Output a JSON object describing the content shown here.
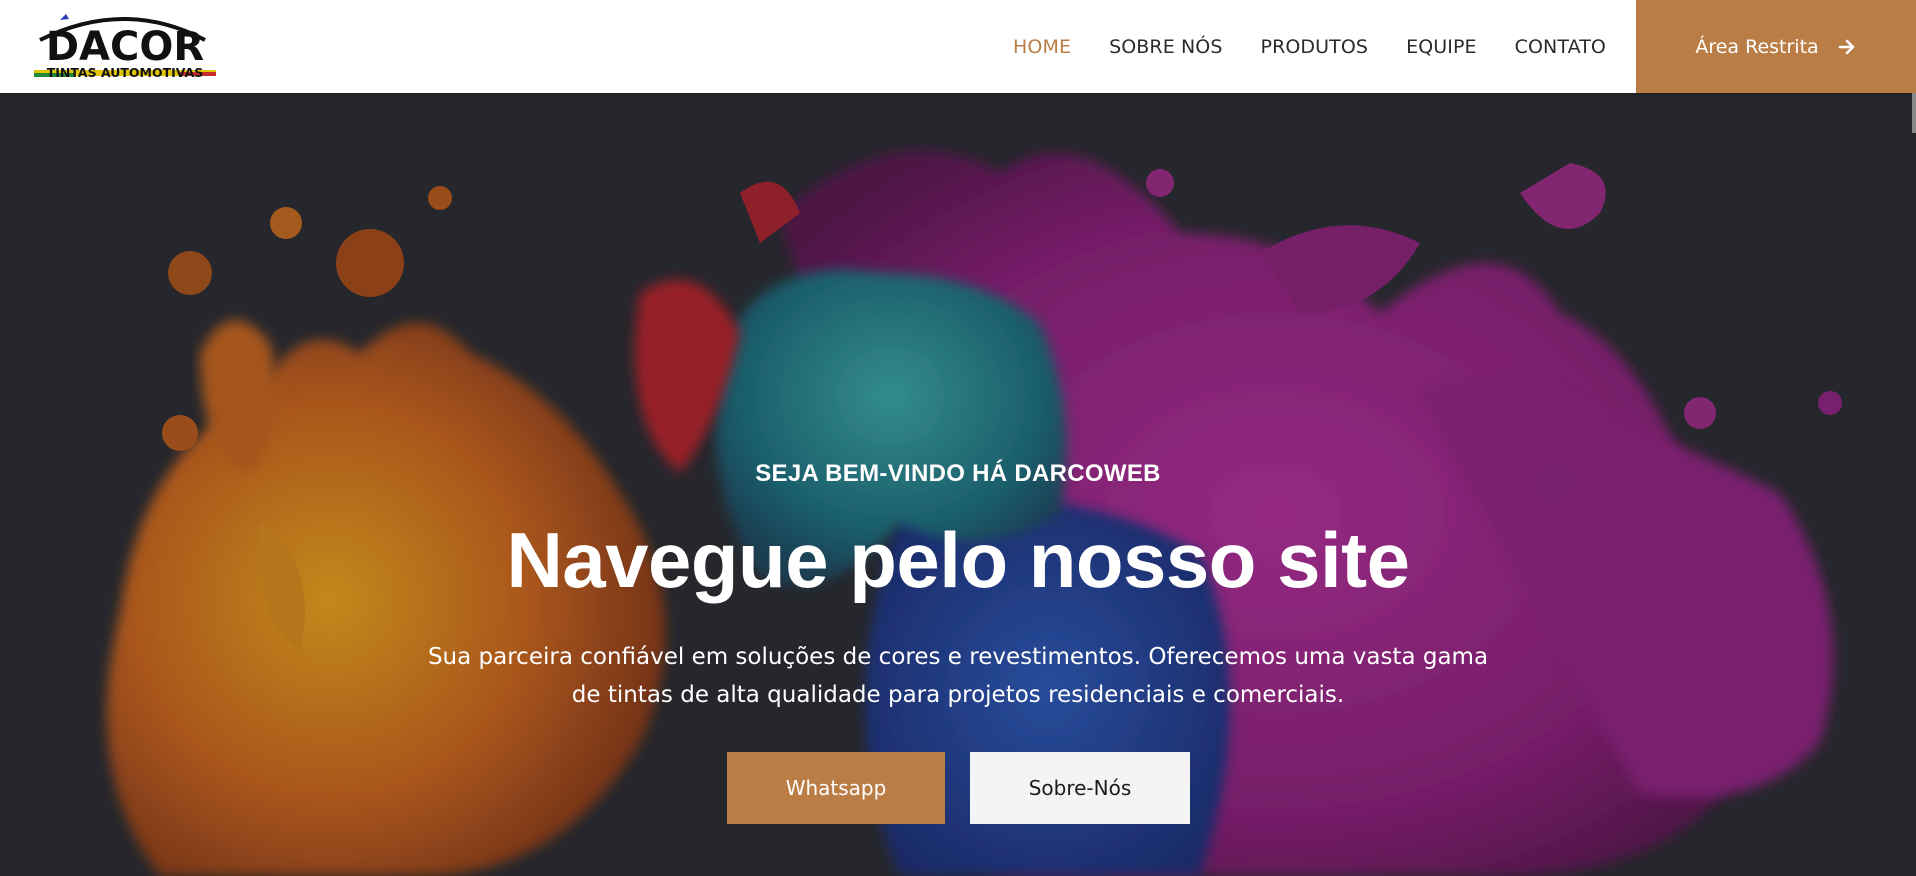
{
  "brand": {
    "name": "DACOR",
    "tagline": "TINTAS AUTOMOTIVAS",
    "accent_color": "#b97d45"
  },
  "nav": {
    "items": [
      {
        "label": "HOME",
        "active": true
      },
      {
        "label": "SOBRE NÓS",
        "active": false
      },
      {
        "label": "PRODUTOS",
        "active": false
      },
      {
        "label": "EQUIPE",
        "active": false
      },
      {
        "label": "CONTATO",
        "active": false
      }
    ],
    "restricted": {
      "label": "Área Restrita",
      "icon": "arrow-right-icon"
    }
  },
  "hero": {
    "eyebrow": "SEJA BEM-VINDO HÁ DARCOWEB",
    "title": "Navegue pelo nosso site",
    "description": "Sua parceira confiável em soluções de cores e revestimentos. Oferecemos uma vasta gama de tintas de alta qualidade para projetos residenciais e comerciais.",
    "buttons": {
      "whatsapp": "Whatsapp",
      "about": "Sobre-Nós"
    }
  }
}
